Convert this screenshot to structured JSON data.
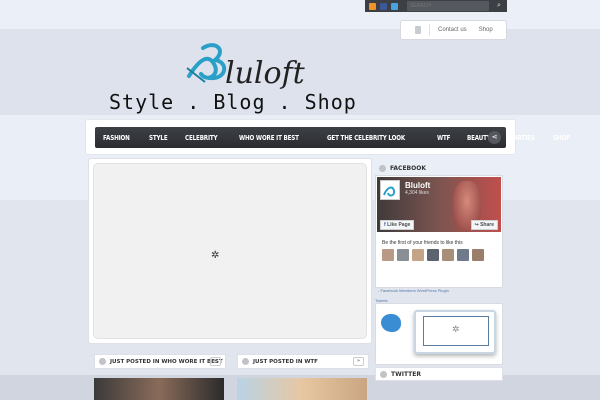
{
  "topbar": {
    "social": [
      {
        "icon": "rss-icon",
        "color": "#f0932b"
      },
      {
        "icon": "facebook-icon",
        "color": "#3b5998"
      },
      {
        "icon": "twitter-icon",
        "color": "#4aa3df"
      }
    ],
    "search_placeholder": "SEARCH"
  },
  "top_menu": {
    "items": [
      "Contact us",
      "Shop"
    ]
  },
  "logo": {
    "wordmark": "luloft",
    "tagline": "Style . Blog . Shop"
  },
  "nav": {
    "items": [
      "FASHION",
      "STYLE",
      "CELEBRITY",
      "WHO WORE IT BEST",
      "GET THE CELEBRITY LOOK",
      "WTF",
      "BEAUTY",
      "PARTIES",
      "SHOP"
    ]
  },
  "sidebar": {
    "facebook_title": "FACEBOOK",
    "fb_page_name": "Bluloft",
    "fb_likes": "4,304 likes",
    "fb_like_btn": "Like Page",
    "fb_share_btn": "Share",
    "fb_friends_text": "Be the first of your friends to like this",
    "fb_plugin_link": "- Facebook Members WordPress Plugin",
    "tweets_label": "Tweets",
    "twitter_title": "TWITTER"
  },
  "posted": [
    {
      "title": "JUST POSTED IN WHO WORE IT BEST"
    },
    {
      "title": "JUST POSTED IN WTF"
    }
  ],
  "colors": {
    "brand_accent": "#2aa0c8"
  }
}
